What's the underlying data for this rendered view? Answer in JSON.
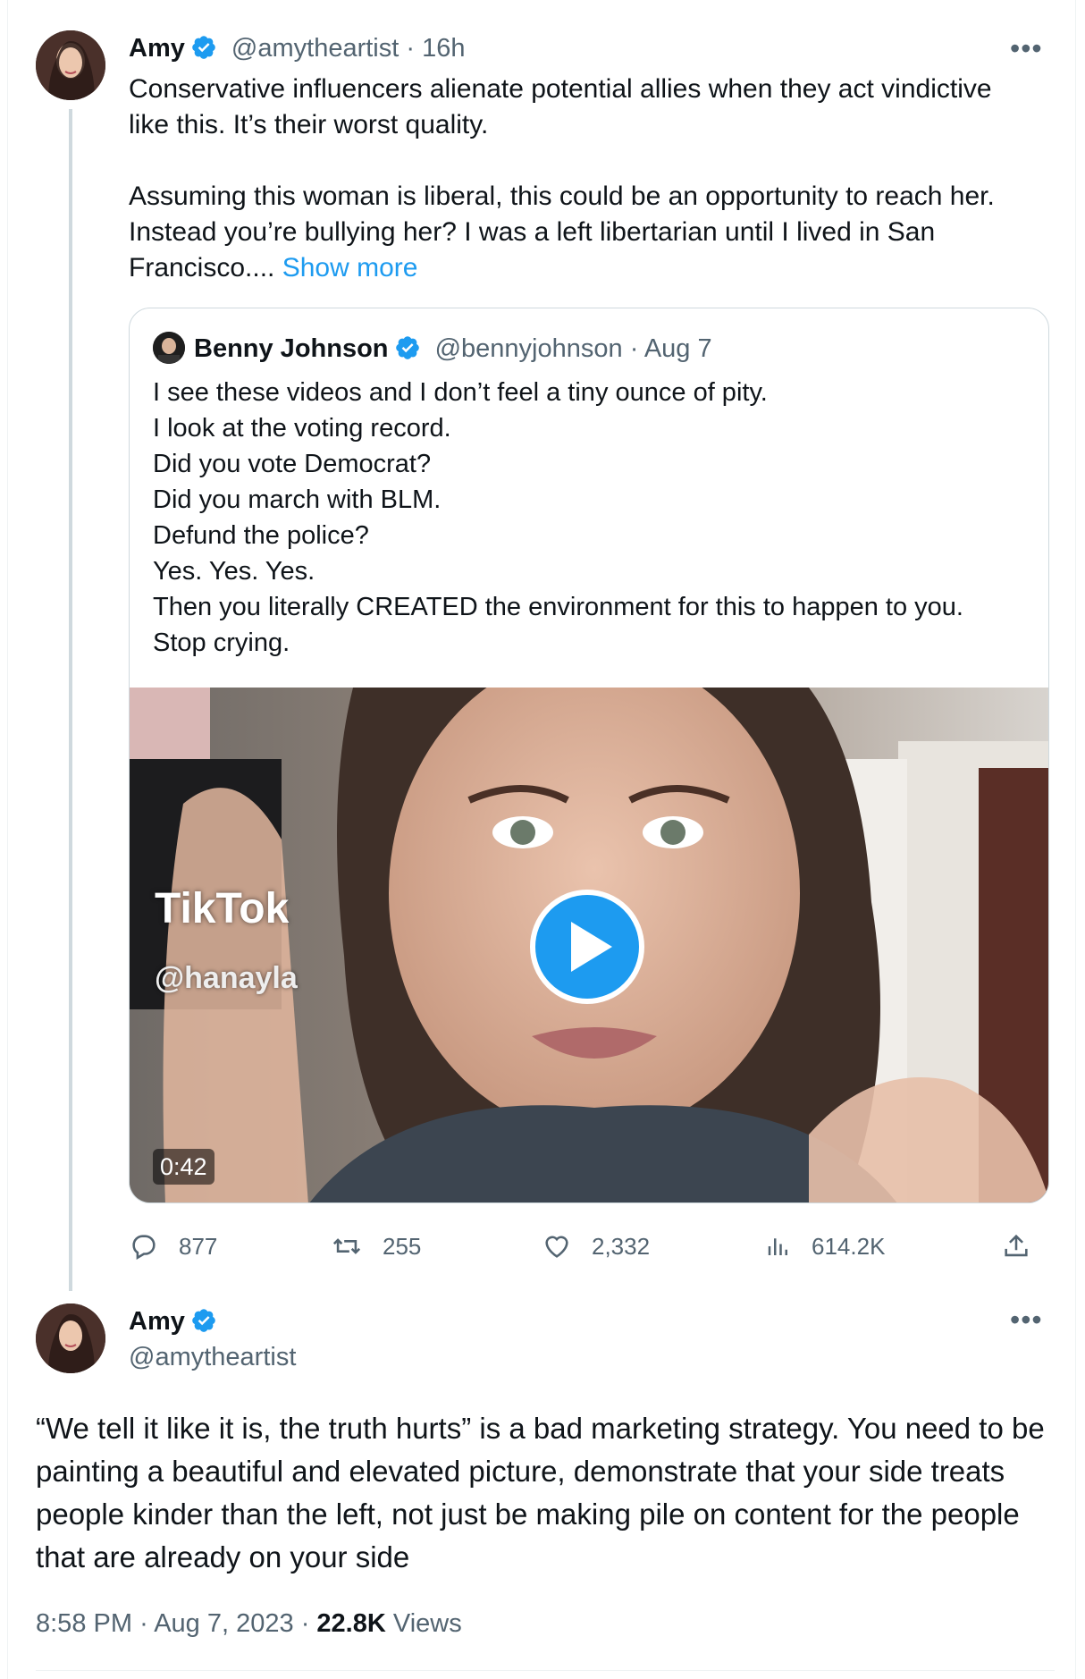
{
  "tweet1": {
    "name": "Amy",
    "handle": "@amytheartist",
    "sep": "·",
    "time": "16h",
    "paragraphs": [
      "Conservative influencers alienate potential allies when they act vindictive like this. It’s their worst quality.",
      "Assuming this woman is liberal, this could be an opportunity to reach her. Instead you’re bullying her? I was a left libertarian until I lived in San Francisco...."
    ],
    "show_more": "Show more",
    "quote": {
      "name": "Benny Johnson",
      "handle": "@bennyjohnson",
      "sep": "·",
      "date": "Aug 7",
      "lines": [
        "I see these videos and I don’t feel a tiny ounce of pity.",
        "I look at the voting record.",
        "Did you vote Democrat?",
        "Did you march with BLM.",
        "Defund the police?",
        "Yes. Yes. Yes.",
        "Then you literally CREATED the environment for this to happen to you.",
        "Stop crying."
      ],
      "video": {
        "watermark_brand": "TikTok",
        "watermark_handle": "@hanayla",
        "duration": "0:42"
      }
    },
    "actions": {
      "replies": "877",
      "retweets": "255",
      "likes": "2,332",
      "views": "614.2K"
    }
  },
  "tweet2": {
    "name": "Amy",
    "handle": "@amytheartist",
    "text": "“We tell it like it is, the truth hurts” is a bad marketing strategy. You need to be painting a beautiful and elevated picture, demonstrate that your side treats people kinder than the left, not just be making pile on content for the people that are already on your side",
    "time": "8:58 PM",
    "sep1": "·",
    "date": "Aug 7, 2023",
    "sep2": "·",
    "views_count": "22.8K",
    "views_label": "Views"
  },
  "colors": {
    "accent": "#1d9bf0",
    "text": "#0f1419",
    "muted": "#536471",
    "border": "#cfd9de"
  },
  "icons": [
    "verified-badge-icon",
    "more-icon",
    "reply-icon",
    "retweet-icon",
    "like-icon",
    "views-icon",
    "share-icon",
    "play-icon"
  ]
}
